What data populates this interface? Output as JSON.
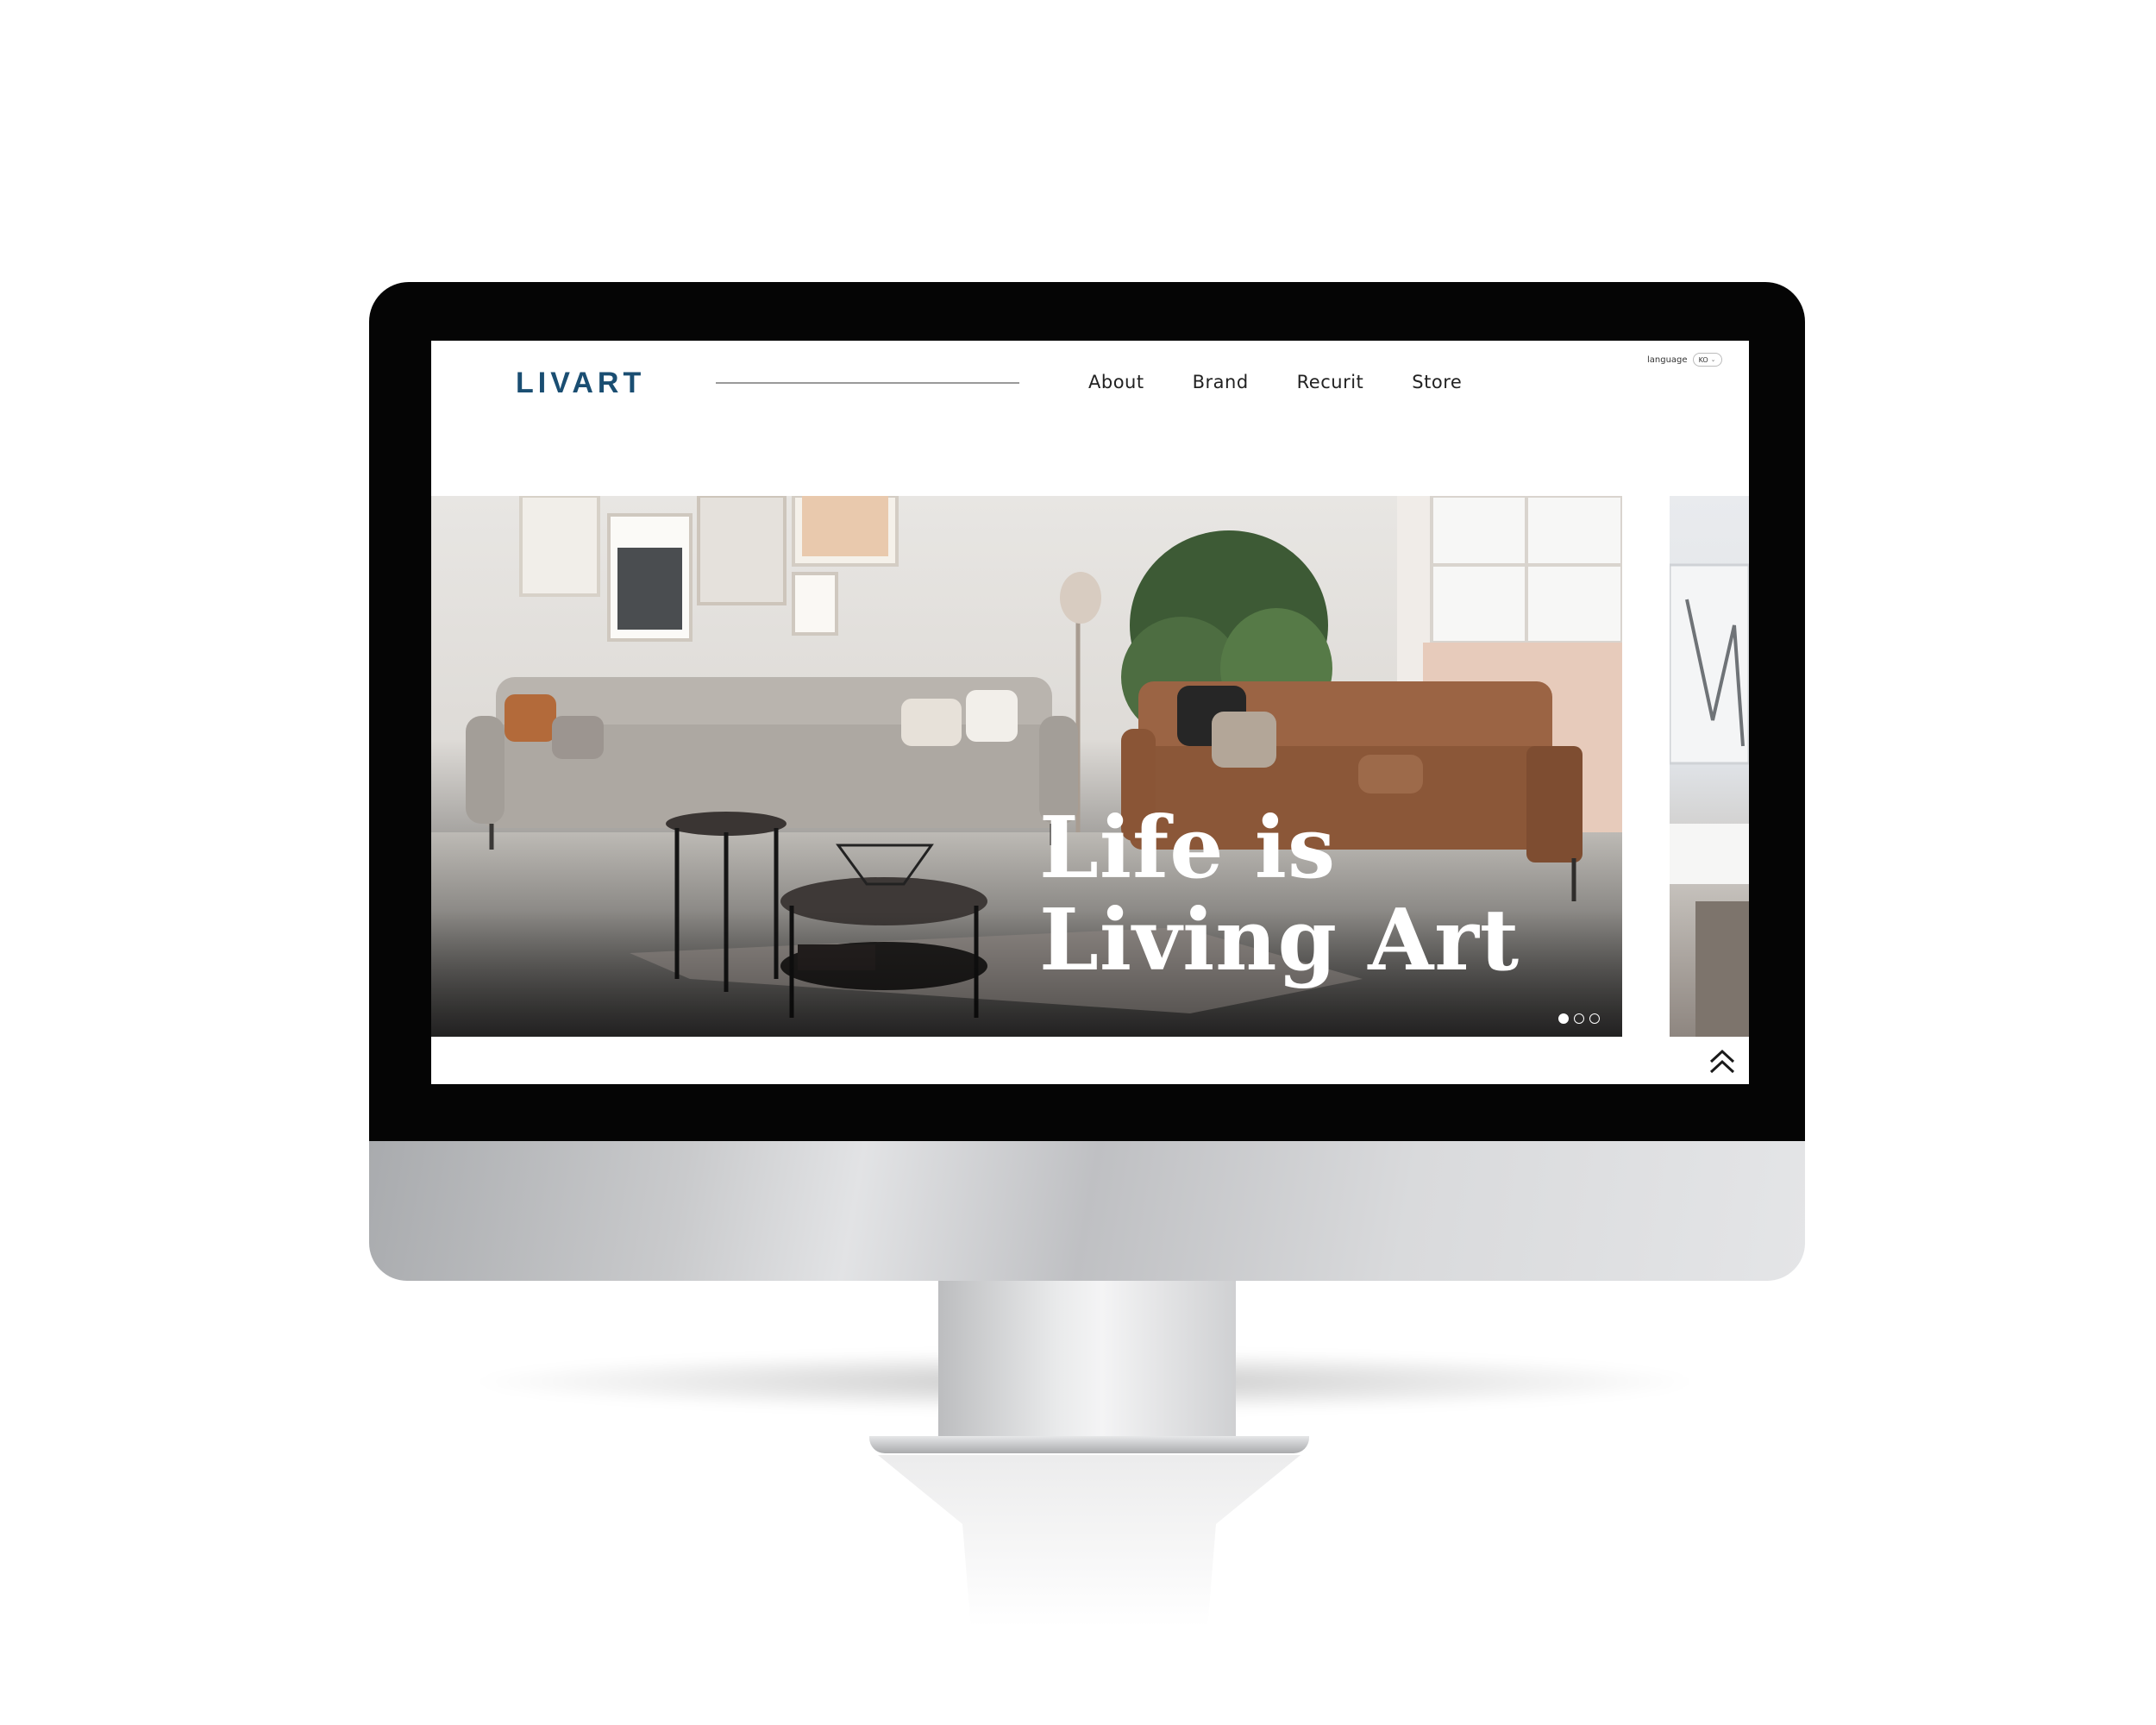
{
  "site": {
    "logo": "LIVART",
    "nav": [
      "About",
      "Brand",
      "Recurit",
      "Store"
    ],
    "language": {
      "label": "language",
      "selected": "KO"
    }
  },
  "hero": {
    "title_line1": "Life is",
    "title_line2": "Living Art",
    "slides_total": 3,
    "active_slide": 1
  },
  "icons": {
    "scroll_top": "double-chevron-up-icon",
    "language_dropdown": "chevron-down-icon"
  },
  "colors": {
    "brand": "#1a4e72",
    "sofa_grey": "#b5b0aa",
    "sofa_brown": "#94603f"
  }
}
